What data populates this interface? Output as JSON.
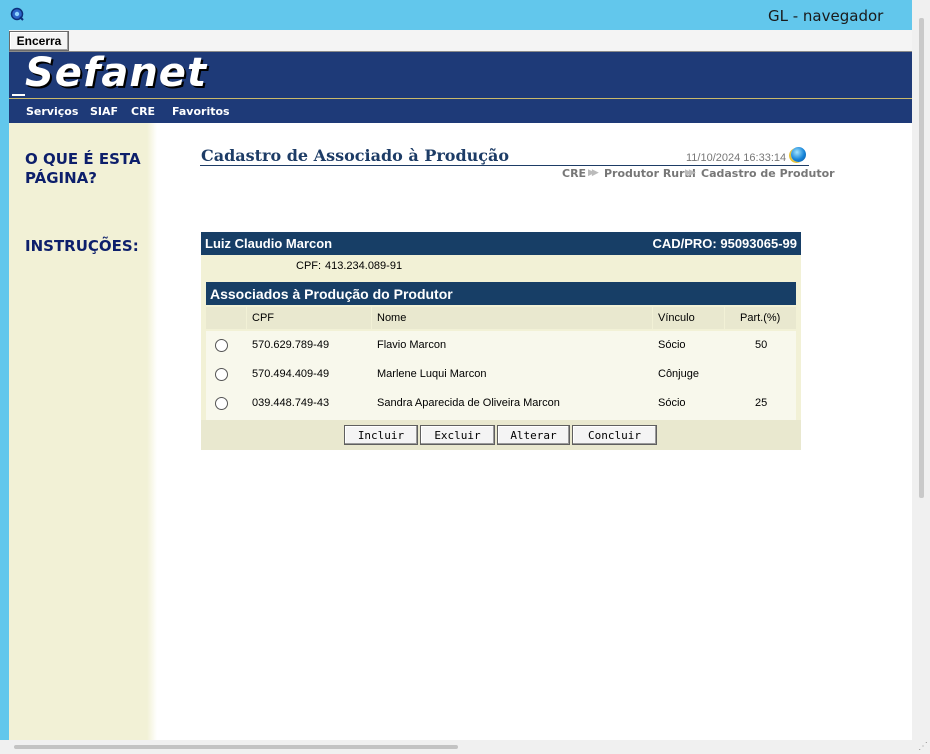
{
  "window": {
    "title": "GL - navegador",
    "icon": "browser-app-icon"
  },
  "toolbar": {
    "encerra_label": "Encerra"
  },
  "header": {
    "logo": "Sefanet",
    "menu": [
      "Serviços",
      "SIAF",
      "CRE",
      "Favoritos"
    ]
  },
  "help": {
    "what_is_line1": "O QUE É ESTA",
    "what_is_line2": "PÁGINA?",
    "instructions": "INSTRUÇÕES:"
  },
  "page": {
    "title": "Cadastro de Associado à Produção",
    "timestamp": "11/10/2024 16:33:14",
    "breadcrumb": [
      "CRE",
      "Produtor Rural",
      "Cadastro de Produtor"
    ]
  },
  "producer": {
    "name": "Luiz Claudio Marcon",
    "cadpro_label": "CAD/PRO: 95093065-99",
    "cpf_label": "CPF:",
    "cpf": "413.234.089-91"
  },
  "associates": {
    "title": "Associados à Produção do Produtor",
    "columns": [
      "CPF",
      "Nome",
      "Vínculo",
      "Part.(%)"
    ],
    "rows": [
      {
        "cpf": "570.629.789-49",
        "nome": "Flavio Marcon",
        "vinculo": "Sócio",
        "part": "50",
        "selected": false
      },
      {
        "cpf": "570.494.409-49",
        "nome": "Marlene Luqui Marcon",
        "vinculo": "Cônjuge",
        "part": "",
        "selected": false
      },
      {
        "cpf": "039.448.749-43",
        "nome": "Sandra Aparecida de Oliveira Marcon",
        "vinculo": "Sócio",
        "part": "25",
        "selected": false
      }
    ]
  },
  "actions": {
    "incluir": "Incluir",
    "excluir": "Excluir",
    "alterar": "Alterar",
    "concluir": "Concluir"
  },
  "colors": {
    "titlebar": "#62c7ec",
    "header": "#1e3a78",
    "panel_bar": "#173e66",
    "help_bg": "#f2f1d6"
  }
}
